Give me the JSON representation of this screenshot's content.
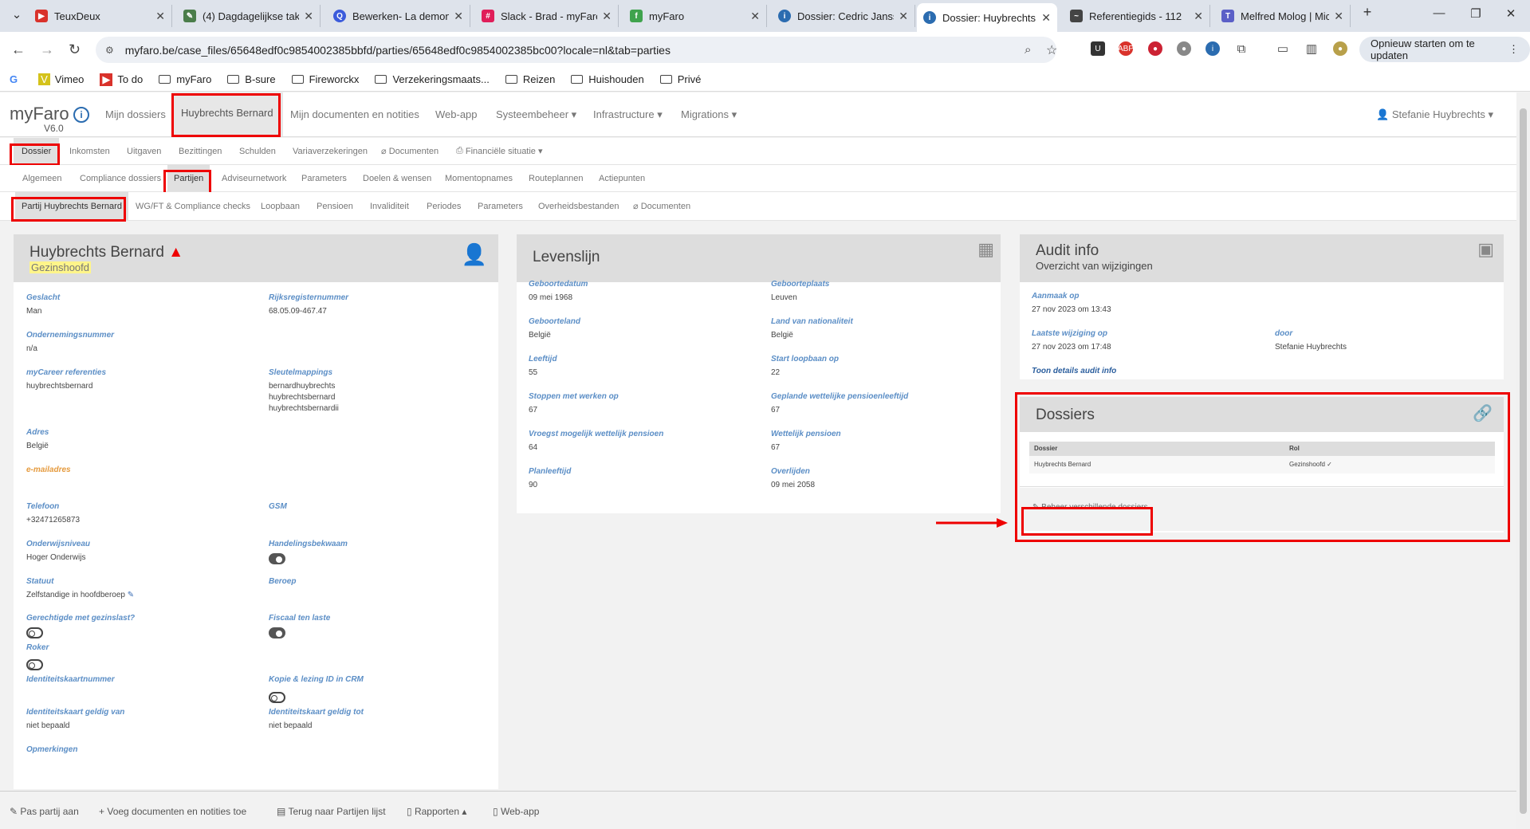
{
  "browser": {
    "tabs": [
      {
        "title": "TeuxDeux",
        "icon": "teuxdeux-icon",
        "color": "#d9322b"
      },
      {
        "title": "(4) Dagdagelijkse tak",
        "icon": "pen-icon",
        "color": "#4a7d4a"
      },
      {
        "title": "Bewerken- La demons",
        "icon": "q-icon",
        "color": "#3b5bdb"
      },
      {
        "title": "Slack - Brad - myFaro",
        "icon": "slack-icon",
        "color": "#e01e5a"
      },
      {
        "title": "myFaro",
        "icon": "myfaro-icon",
        "color": "#3fa34d"
      },
      {
        "title": "Dossier: Cedric Janss",
        "icon": "info-icon",
        "color": "#2b6cb0"
      },
      {
        "title": "Dossier: Huybrechts",
        "icon": "info-icon",
        "color": "#2b6cb0"
      },
      {
        "title": "Referentiegids - 112",
        "icon": "wave-icon",
        "color": "#444"
      },
      {
        "title": "Melfred Molog | Mic",
        "icon": "teams-icon",
        "color": "#5b5fc7"
      }
    ],
    "url": "myfaro.be/case_files/65648edf0c9854002385bbfd/parties/65648edf0c9854002385bc00?locale=nl&tab=parties",
    "update_button": "Opnieuw starten om te updaten",
    "bookmarks": [
      {
        "label": "Vimeo",
        "type": "link"
      },
      {
        "label": "To do",
        "type": "link"
      },
      {
        "label": "myFaro",
        "type": "folder"
      },
      {
        "label": "B-sure",
        "type": "folder"
      },
      {
        "label": "Fireworckx",
        "type": "folder"
      },
      {
        "label": "Verzekeringsmaats...",
        "type": "folder"
      },
      {
        "label": "Reizen",
        "type": "folder"
      },
      {
        "label": "Huishouden",
        "type": "folder"
      },
      {
        "label": "Privé",
        "type": "folder"
      }
    ]
  },
  "app": {
    "brand": "myFaro",
    "version": "V6.0",
    "topnav": [
      "Mijn dossiers",
      "Huybrechts Bernard",
      "Mijn documenten en notities",
      "Web-app",
      "Systeembeheer",
      "Infrastructure",
      "Migrations"
    ],
    "user": "Stefanie Huybrechts",
    "subnav1": [
      "Dossier",
      "Inkomsten",
      "Uitgaven",
      "Bezittingen",
      "Schulden",
      "Variaverzekeringen",
      "Documenten",
      "Financiële situatie"
    ],
    "subnav2": [
      "Algemeen",
      "Compliance dossiers",
      "Partijen",
      "Adviseurnetwork",
      "Parameters",
      "Doelen & wensen",
      "Momentopnames",
      "Routeplannen",
      "Actiepunten"
    ],
    "subnav3": [
      "Partij Huybrechts Bernard",
      "WG/FT & Compliance checks",
      "Loopbaan",
      "Pensioen",
      "Invaliditeit",
      "Periodes",
      "Parameters",
      "Overheidsbestanden",
      "Documenten"
    ]
  },
  "party": {
    "name": "Huybrechts Bernard",
    "role": "Gezinshoofd",
    "geslacht_l": "Geslacht",
    "geslacht": "Man",
    "rijks_l": "Rijksregisternummer",
    "rijks": "68.05.09-467.47",
    "onderneming_l": "Ondernemingsnummer",
    "onderneming": "n/a",
    "mycareer_l": "myCareer referenties",
    "mycareer": "huybrechtsbernard",
    "sleutel_l": "Sleutelmappings",
    "sleutel1": "bernardhuybrechts",
    "sleutel2": "huybrechtsbernard",
    "sleutel3": "huybrechtsbernardii",
    "adres_l": "Adres",
    "adres": "België",
    "email_l": "e-mailadres",
    "telefoon_l": "Telefoon",
    "telefoon": "+32471265873",
    "gsm_l": "GSM",
    "onderwijs_l": "Onderwijsniveau",
    "onderwijs": "Hoger Onderwijs",
    "handeling_l": "Handelingsbekwaam",
    "statuut_l": "Statuut",
    "statuut": "Zelfstandige in hoofdberoep",
    "beroep_l": "Beroep",
    "gerechtigde_l": "Gerechtigde met gezinslast?",
    "fiscaal_l": "Fiscaal ten laste",
    "roker_l": "Roker",
    "idnr_l": "Identiteitskaartnummer",
    "kopie_l": "Kopie & lezing ID in CRM",
    "idvan_l": "Identiteitskaart geldig van",
    "idvan": "niet bepaald",
    "idtot_l": "Identiteitskaart geldig tot",
    "idtot": "niet bepaald",
    "opm_l": "Opmerkingen"
  },
  "levenslijn": {
    "title": "Levenslijn",
    "gebdatum_l": "Geboortedatum",
    "gebdatum": "09 mei 1968",
    "gebplaats_l": "Geboorteplaats",
    "gebplaats": "Leuven",
    "gebland_l": "Geboorteland",
    "gebland": "België",
    "nat_l": "Land van nationaliteit",
    "nat": "België",
    "leeftijd_l": "Leeftijd",
    "leeftijd": "55",
    "startlb_l": "Start loopbaan op",
    "startlb": "22",
    "stoppen_l": "Stoppen met werken op",
    "stoppen": "67",
    "gepland_l": "Geplande wettelijke pensioenleeftijd",
    "gepland": "67",
    "vroegst_l": "Vroegst mogelijk wettelijk pensioen",
    "vroegst": "64",
    "wettelijk_l": "Wettelijk pensioen",
    "wettelijk": "67",
    "plan_l": "Planleeftijd",
    "plan": "90",
    "overl_l": "Overlijden",
    "overl": "09 mei 2058"
  },
  "audit": {
    "title": "Audit info",
    "subtitle": "Overzicht van wijzigingen",
    "aanmaak_l": "Aanmaak op",
    "aanmaak": "27 nov 2023 om 13:43",
    "laatste_l": "Laatste wijziging op",
    "laatste": "27 nov 2023 om 17:48",
    "door_l": "door",
    "door": "Stefanie Huybrechts",
    "details": "Toon details audit info"
  },
  "dossiers": {
    "title": "Dossiers",
    "col_dossier": "Dossier",
    "col_rol": "Rol",
    "row_dossier": "Huybrechts Bernard",
    "row_rol": "Gezinshoofd",
    "beheer": "Beheer verschillende dossiers"
  },
  "bottom": [
    "Pas partij aan",
    "Voeg documenten en notities toe",
    "Terug naar Partijen lijst",
    "Rapporten",
    "Web-app"
  ]
}
